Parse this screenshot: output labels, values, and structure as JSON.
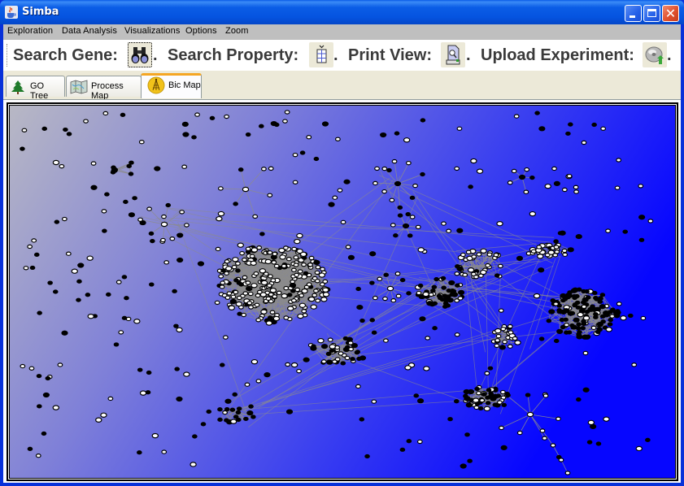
{
  "window": {
    "title": "Simba",
    "controls": {
      "minimize": "minimize",
      "maximize": "maximize",
      "close": "close"
    }
  },
  "menubar": {
    "items": [
      {
        "label": "Exploration"
      },
      {
        "label": "Data Analysis"
      },
      {
        "label": "Visualizations"
      },
      {
        "label": "Options"
      },
      {
        "label": "Zoom"
      }
    ]
  },
  "toolbar": {
    "items": [
      {
        "label": "Search Gene:",
        "icon": "binoculars-icon",
        "suffix": "."
      },
      {
        "label": "Search Property:",
        "icon": "property-table-icon",
        "suffix": "."
      },
      {
        "label": "Print View:",
        "icon": "print-preview-icon",
        "suffix": "."
      },
      {
        "label": "Upload Experiment:",
        "icon": "upload-disc-icon",
        "suffix": "."
      }
    ]
  },
  "tabs": {
    "items": [
      {
        "label": "GO Tree",
        "icon": "pine-tree-icon",
        "active": false
      },
      {
        "label": "Process Map",
        "icon": "folded-map-icon",
        "active": false
      },
      {
        "label": "Bic Map",
        "icon": "bic-map-icon",
        "active": true
      }
    ]
  },
  "graph": {
    "description": "Bicluster network map with gene nodes and gray edges",
    "background_gradient": {
      "from": "#b4b4c4",
      "to": "#0000ff"
    },
    "edge_color": "#8c8c8c",
    "node_fill_white": "#ffffff",
    "node_fill_black": "#000000",
    "clusters": [
      {
        "name": "dense-core",
        "size": "large"
      },
      {
        "name": "mid-cluster-left",
        "size": "medium"
      },
      {
        "name": "right-hub",
        "size": "large"
      },
      {
        "name": "upper-right-fan",
        "size": "medium"
      },
      {
        "name": "bottom-fan",
        "size": "medium"
      },
      {
        "name": "bottom-left-cluster",
        "size": "small"
      },
      {
        "name": "center-wedge",
        "size": "medium"
      }
    ]
  }
}
